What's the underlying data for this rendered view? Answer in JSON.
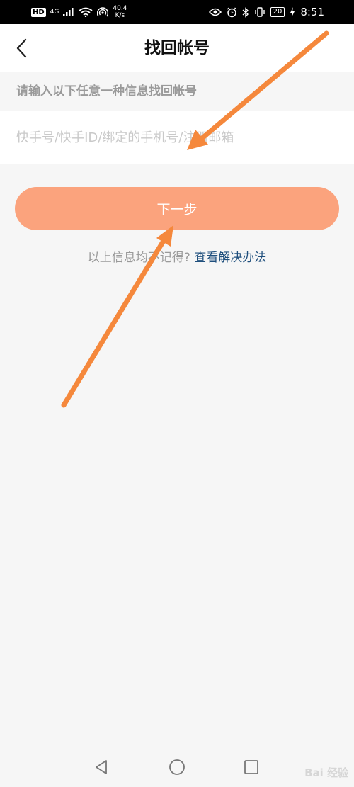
{
  "status_bar": {
    "hd": "HD",
    "network": "4G",
    "speed_value": "40.4",
    "speed_unit": "K/s",
    "battery": "20",
    "time": "8:51"
  },
  "header": {
    "title": "找回帐号"
  },
  "form": {
    "prompt": "请输入以下任意一种信息找回帐号",
    "account_placeholder": "快手号/快手ID/绑定的手机号/注册邮箱",
    "account_value": ""
  },
  "actions": {
    "next_label": "下一步",
    "forgot_text": "以上信息均不记得?",
    "solution_link": "查看解决办法"
  },
  "watermark": "Bai 经验",
  "colors": {
    "accent": "#fba37d",
    "link": "#1f4f7d",
    "annotation_arrow": "#f5883c"
  }
}
